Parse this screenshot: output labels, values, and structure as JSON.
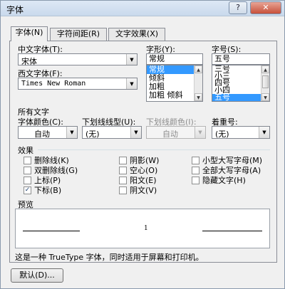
{
  "window": {
    "title": "字体",
    "help_label": "?",
    "close_label": "✕"
  },
  "tabs": [
    {
      "label": "字体(N)"
    },
    {
      "label": "字符间距(R)"
    },
    {
      "label": "文字效果(X)"
    }
  ],
  "font": {
    "chinese_label": "中文字体(T):",
    "chinese_value": "宋体",
    "western_label": "西文字体(F):",
    "western_value": "Times New Roman",
    "style_label": "字形(Y):",
    "style_value": "常规",
    "style_options": [
      "常规",
      "倾斜",
      "加粗",
      "加粗 倾斜"
    ],
    "size_label": "字号(S):",
    "size_value": "五号",
    "size_options": [
      "三号",
      "小三",
      "四号",
      "小四",
      "五号"
    ]
  },
  "all_text": {
    "section_label": "所有文字",
    "color_label": "字体颜色(C):",
    "color_value": "自动",
    "underline_label": "下划线线型(U):",
    "underline_value": "(无)",
    "underline_color_label": "下划线颜色(I):",
    "underline_color_value": "自动",
    "emphasis_label": "着重号:",
    "emphasis_value": "(无)"
  },
  "effects": {
    "section_label": "效果",
    "items": [
      {
        "label": "删除线(K)",
        "checked": false
      },
      {
        "label": "双删除线(G)",
        "checked": false
      },
      {
        "label": "上标(P)",
        "checked": false
      },
      {
        "label": "下标(B)",
        "checked": true
      },
      {
        "label": "阴影(W)",
        "checked": false
      },
      {
        "label": "空心(O)",
        "checked": false
      },
      {
        "label": "阳文(E)",
        "checked": false
      },
      {
        "label": "阴文(V)",
        "checked": false
      },
      {
        "label": "小型大写字母(M)",
        "checked": false
      },
      {
        "label": "全部大写字母(A)",
        "checked": false
      },
      {
        "label": "隐藏文字(H)",
        "checked": false
      }
    ]
  },
  "preview": {
    "section_label": "预览",
    "sample_text": "1",
    "note": "这是一种 TrueType 字体，同时适用于屏幕和打印机。"
  },
  "buttons": {
    "default_label": "默认(D)..."
  }
}
